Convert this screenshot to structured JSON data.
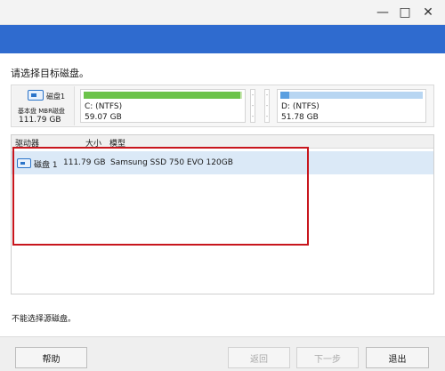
{
  "window": {
    "min_glyph": "—",
    "max_glyph": "□",
    "close_glyph": "✕"
  },
  "instruction": "请选择目标磁盘。",
  "disk_map": {
    "disk": {
      "name": "磁盘1",
      "type": "基本盘 MBR磁盘",
      "size": "111.79 GB"
    },
    "partitions": [
      {
        "label": "C: (NTFS)",
        "size": "59.07 GB",
        "used_fraction": 0.99
      },
      {
        "label": "D: (NTFS)",
        "size": "51.78 GB",
        "used_fraction": 0.06
      }
    ],
    "separator_glyph": "-"
  },
  "table": {
    "columns": [
      "驱动器",
      "大小",
      "模型"
    ],
    "rows": [
      {
        "drive": "磁盘 1",
        "size": "111.79 GB",
        "model": "Samsung SSD 750 EVO 120GB"
      }
    ]
  },
  "status_message": "不能选择源磁盘。",
  "buttons": {
    "help": "帮助",
    "back": "返回",
    "next": "下一步",
    "exit": "退出"
  },
  "colors": {
    "title_bar": "#2f6bcf",
    "selection": "#dbe9f7",
    "highlight_box": "#c8161d",
    "used_c": "#6cc34a",
    "used_d": "#5a9fe0"
  }
}
